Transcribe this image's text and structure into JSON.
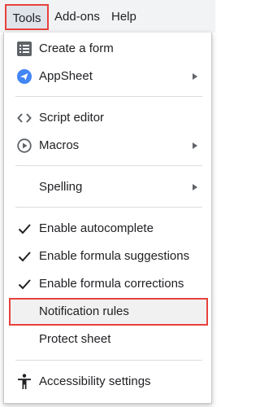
{
  "menubar": {
    "tools": "Tools",
    "addons": "Add-ons",
    "help": "Help"
  },
  "menu": {
    "items": [
      {
        "label": "Create a form",
        "icon": "form-list-icon"
      },
      {
        "label": "AppSheet",
        "icon": "appsheet-icon",
        "submenu": true
      },
      {
        "label": "Script editor",
        "icon": "code-icon"
      },
      {
        "label": "Macros",
        "icon": "play-circle-icon",
        "submenu": true
      },
      {
        "label": "Spelling",
        "submenu": true
      },
      {
        "label": "Enable autocomplete",
        "icon": "check-icon"
      },
      {
        "label": "Enable formula suggestions",
        "icon": "check-icon"
      },
      {
        "label": "Enable formula corrections",
        "icon": "check-icon"
      },
      {
        "label": "Notification rules",
        "highlighted": true
      },
      {
        "label": "Protect sheet"
      },
      {
        "label": "Accessibility settings",
        "icon": "accessibility-icon"
      }
    ]
  },
  "colors": {
    "highlight_border": "#e8413c",
    "appsheet_blue": "#4285f4",
    "text": "#202124",
    "icon_gray": "#5f6368"
  }
}
